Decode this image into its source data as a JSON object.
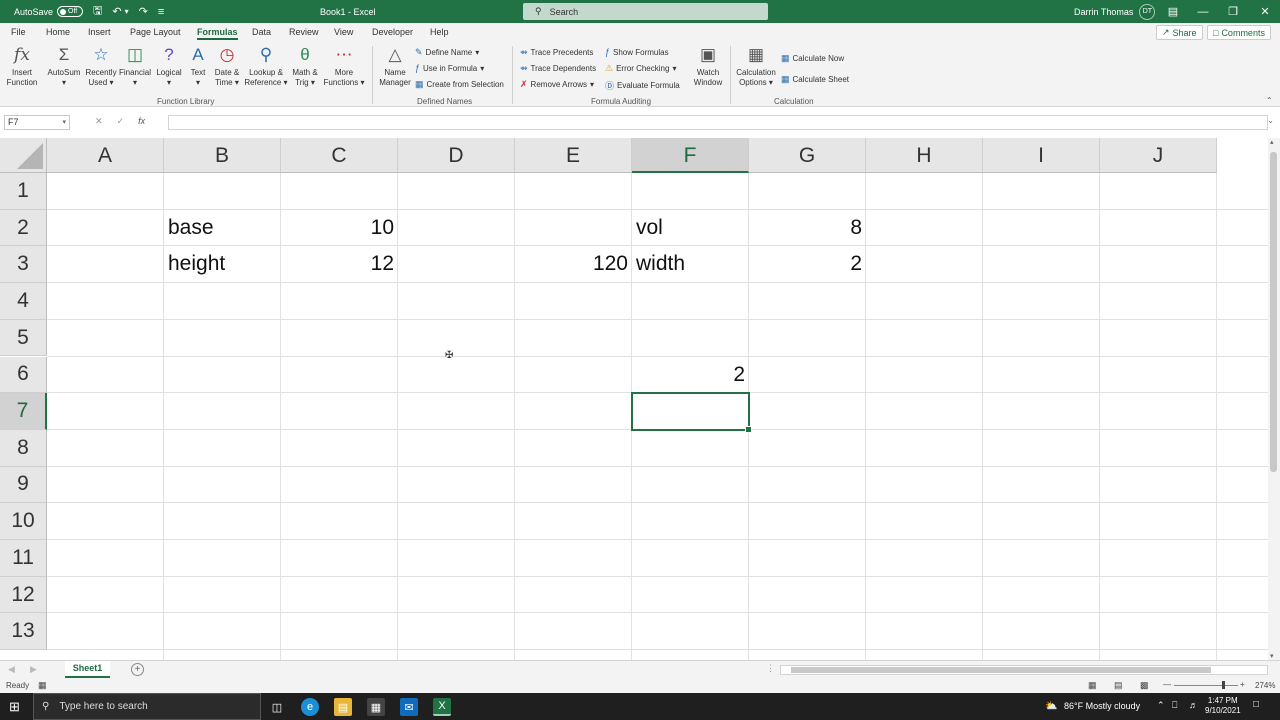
{
  "titlebar": {
    "autosave_label": "AutoSave",
    "autosave_state": "Off",
    "doc_title": "Book1 - Excel",
    "search_placeholder": "Search",
    "user_name": "Darrin Thomas",
    "user_initials": "DT"
  },
  "menu": {
    "tabs": [
      "File",
      "Home",
      "Insert",
      "Page Layout",
      "Formulas",
      "Data",
      "Review",
      "View",
      "Developer",
      "Help"
    ],
    "active_tab": "Formulas",
    "share_label": "Share",
    "comments_label": "Comments"
  },
  "ribbon": {
    "function_library": {
      "label": "Function Library",
      "buttons": [
        {
          "line1": "Insert",
          "line2": "Function"
        },
        {
          "line1": "AutoSum",
          "line2": ""
        },
        {
          "line1": "Recently",
          "line2": "Used"
        },
        {
          "line1": "Financial",
          "line2": ""
        },
        {
          "line1": "Logical",
          "line2": ""
        },
        {
          "line1": "Text",
          "line2": ""
        },
        {
          "line1": "Date &",
          "line2": "Time"
        },
        {
          "line1": "Lookup &",
          "line2": "Reference"
        },
        {
          "line1": "Math &",
          "line2": "Trig"
        },
        {
          "line1": "More",
          "line2": "Functions"
        }
      ]
    },
    "defined_names": {
      "label": "Defined Names",
      "name_manager": {
        "line1": "Name",
        "line2": "Manager"
      },
      "define_name": "Define Name",
      "use_in_formula": "Use in Formula",
      "create_from_selection": "Create from Selection"
    },
    "formula_auditing": {
      "label": "Formula Auditing",
      "trace_precedents": "Trace Precedents",
      "trace_dependents": "Trace Dependents",
      "remove_arrows": "Remove Arrows",
      "show_formulas": "Show Formulas",
      "error_checking": "Error Checking",
      "evaluate_formula": "Evaluate Formula",
      "watch_window": {
        "line1": "Watch",
        "line2": "Window"
      }
    },
    "calculation": {
      "label": "Calculation",
      "options": {
        "line1": "Calculation",
        "line2": "Options"
      },
      "calculate_now": "Calculate Now",
      "calculate_sheet": "Calculate Sheet"
    }
  },
  "formula_bar": {
    "name_box": "F7",
    "fx_label": "fx",
    "formula": ""
  },
  "sheet": {
    "columns": [
      "A",
      "B",
      "C",
      "D",
      "E",
      "F",
      "G",
      "H",
      "I",
      "J"
    ],
    "rows": [
      "1",
      "2",
      "3",
      "4",
      "5",
      "6",
      "7",
      "8",
      "9",
      "10",
      "11",
      "12",
      "13"
    ],
    "active_cell": "F7",
    "cells": {
      "B2": "base",
      "C2": "10",
      "F2": "vol",
      "G2": "8",
      "B3": "height",
      "C3": "12",
      "E3": "120",
      "F3": "width",
      "G3": "2",
      "F6": "2"
    }
  },
  "sheet_tabs": {
    "tabs": [
      "Sheet1"
    ]
  },
  "status": {
    "ready": "Ready",
    "zoom": "274%"
  },
  "taskbar": {
    "search_placeholder": "Type here to search",
    "weather": "86°F  Mostly cloudy",
    "time": "1:47 PM",
    "date": "9/10/2021"
  }
}
